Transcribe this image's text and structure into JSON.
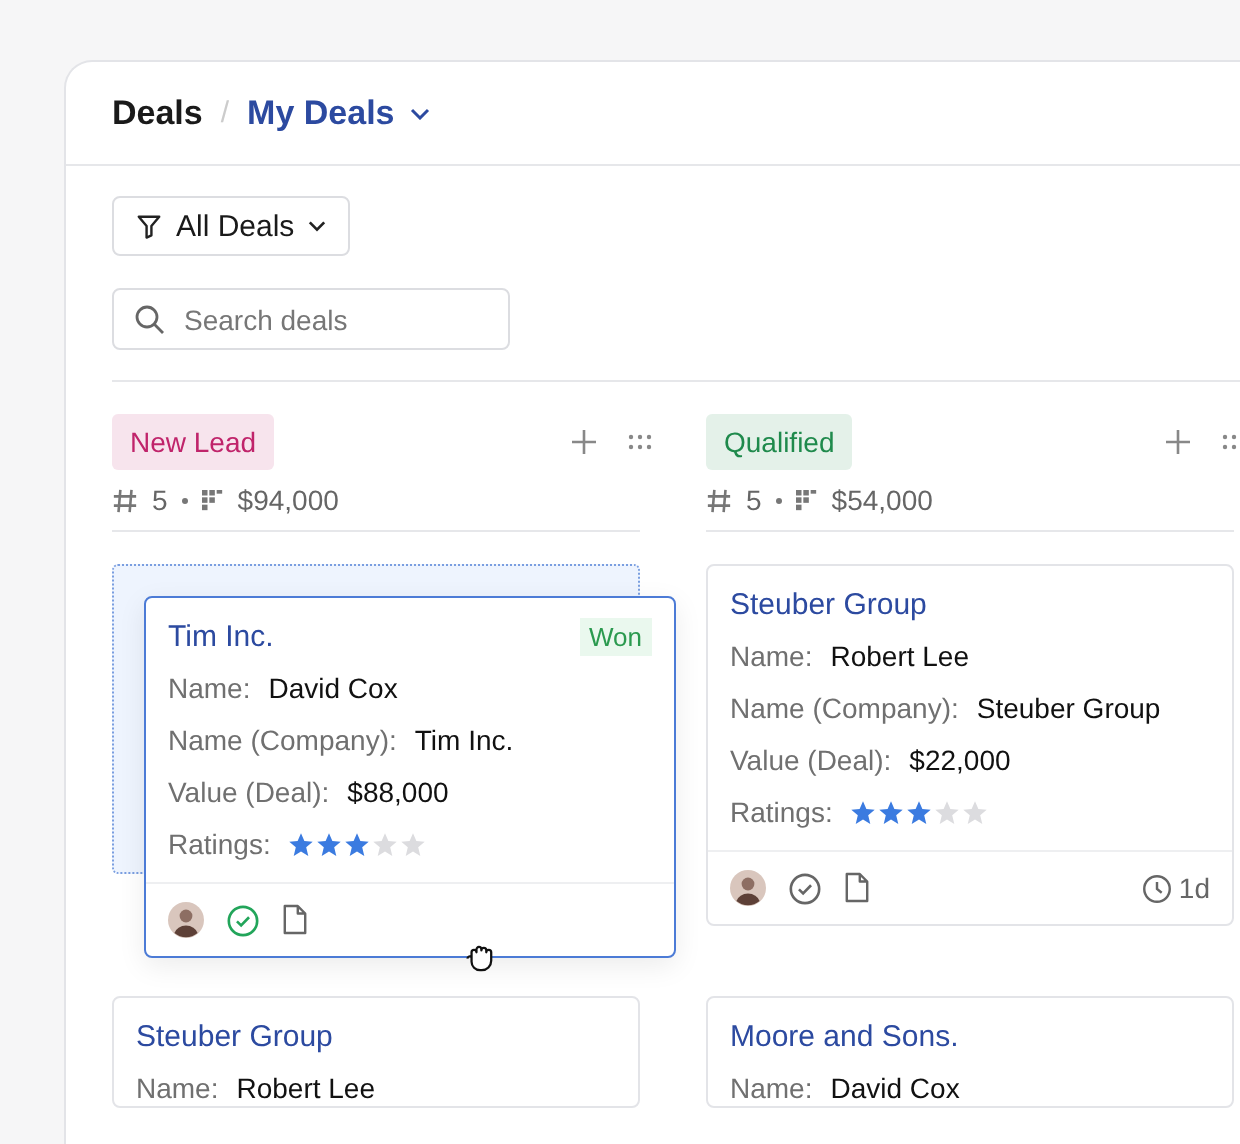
{
  "breadcrumb": {
    "root": "Deals",
    "separator": "/",
    "view": "My Deals"
  },
  "filter": {
    "label": "All Deals"
  },
  "search": {
    "placeholder": "Search deals"
  },
  "columns": [
    {
      "tag": "New Lead",
      "color": "#c0246b",
      "count": "5",
      "amount": "$94,000",
      "cards": [
        {
          "kind": "dragging",
          "title": "Tim Inc.",
          "status": "Won",
          "fields": [
            {
              "label": "Name:",
              "value": "David Cox"
            },
            {
              "label": "Name (Company):",
              "value": "Tim Inc."
            },
            {
              "label": "Value (Deal):",
              "value": "$88,000"
            }
          ],
          "rating_label": "Ratings:",
          "stars": 3,
          "task_done": true
        },
        {
          "kind": "card",
          "title": "Steuber Group",
          "fields": [
            {
              "label": "Name:",
              "value": "Robert Lee"
            }
          ]
        }
      ]
    },
    {
      "tag": "Qualified",
      "color": "#1f8a4c",
      "count": "5",
      "amount": "$54,000",
      "cards": [
        {
          "kind": "card",
          "title": "Steuber Group",
          "fields": [
            {
              "label": "Name:",
              "value": "Robert Lee"
            },
            {
              "label": "Name (Company):",
              "value": "Steuber Group"
            },
            {
              "label": "Value (Deal):",
              "value": "$22,000"
            }
          ],
          "rating_label": "Ratings:",
          "stars": 3,
          "task_done": false,
          "time": "1d"
        },
        {
          "kind": "card",
          "title": "Moore and Sons.",
          "fields": [
            {
              "label": "Name:",
              "value": "David Cox"
            }
          ]
        }
      ]
    }
  ]
}
